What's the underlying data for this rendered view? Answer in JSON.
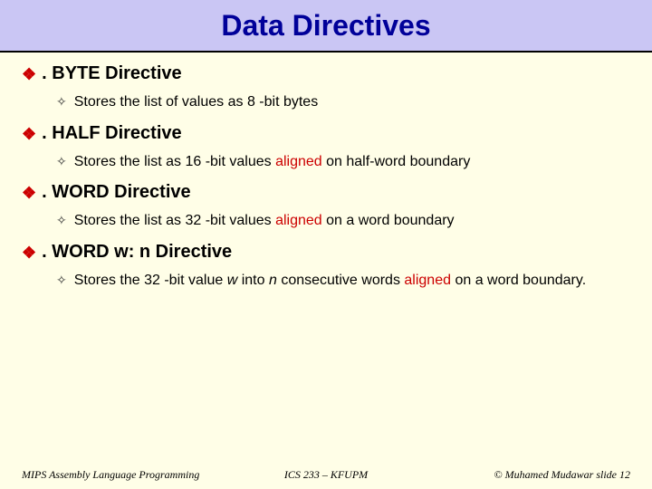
{
  "title": "Data Directives",
  "sections": [
    {
      "heading": ". BYTE Directive",
      "sub": "Stores the list of values as 8 -bit bytes"
    },
    {
      "heading": ". HALF Directive",
      "sub_html": "Stores the list as 16 -bit values <span class='aligned'>aligned</span> on half-word boundary"
    },
    {
      "heading": ". WORD Directive",
      "sub_html": "Stores the list as 32 -bit values <span class='aligned'>aligned</span> on a word boundary"
    },
    {
      "heading": ". WORD w: n Directive",
      "sub_html": "Stores the 32 -bit value <span class='italic'>w</span> into <span class='italic'>n</span> consecutive words <span class='aligned'>aligned</span> on a word boundary."
    }
  ],
  "footer": {
    "left": "MIPS Assembly Language Programming",
    "center": "ICS 233 – KFUPM",
    "right": "© Muhamed Mudawar   slide 12"
  }
}
